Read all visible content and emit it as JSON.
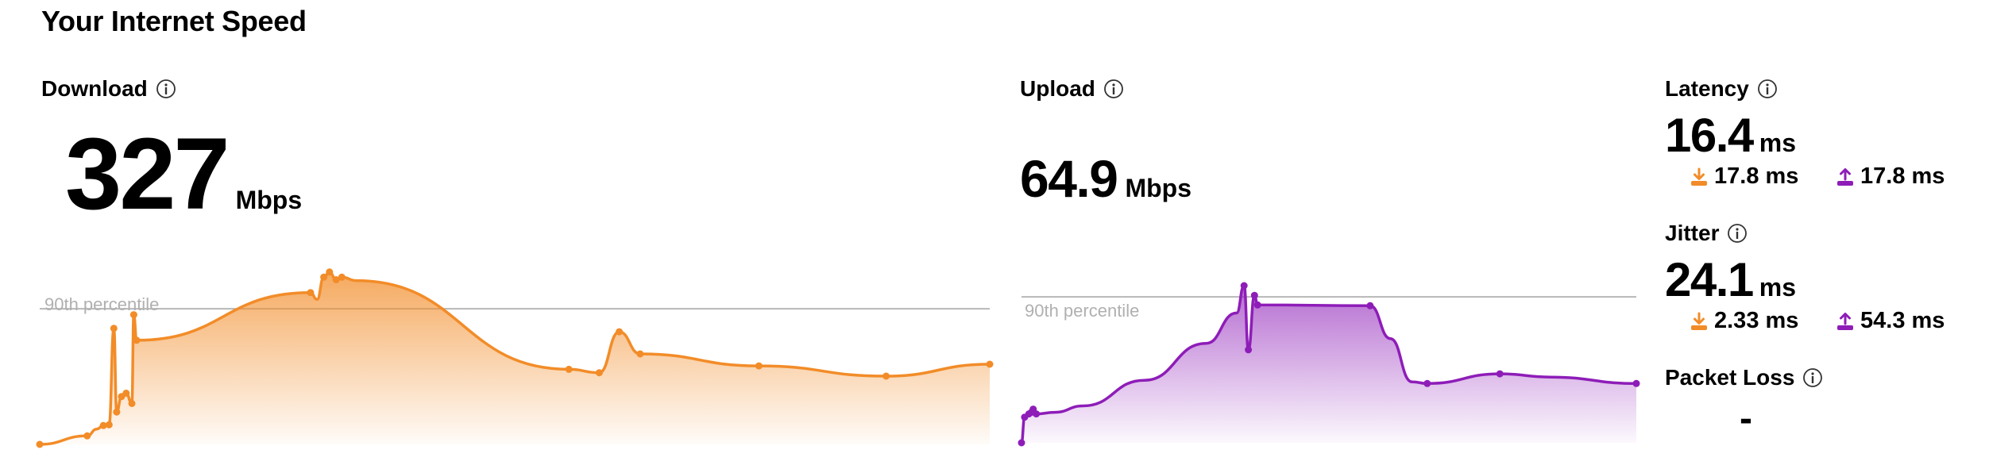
{
  "page": {
    "title": "Your Internet Speed"
  },
  "colors": {
    "download": "#f28c28",
    "upload": "#8e1db8",
    "reference_line": "#b7b7b7",
    "reference_text": "#b0b0b0"
  },
  "download": {
    "label": "Download",
    "value": "327",
    "unit": "Mbps",
    "percentile_label": "90th percentile",
    "info_icon": "info-circle-icon"
  },
  "upload": {
    "label": "Upload",
    "value": "64.9",
    "unit": "Mbps",
    "percentile_label": "90th percentile",
    "info_icon": "info-circle-icon"
  },
  "latency": {
    "label": "Latency",
    "value": "16.4",
    "unit": "ms",
    "down_value": "17.8 ms",
    "up_value": "17.8 ms",
    "down_icon": "download-arrow-icon",
    "up_icon": "upload-arrow-icon"
  },
  "jitter": {
    "label": "Jitter",
    "value": "24.1",
    "unit": "ms",
    "down_value": "2.33 ms",
    "up_value": "54.3 ms",
    "down_icon": "download-arrow-icon",
    "up_icon": "upload-arrow-icon"
  },
  "packet_loss": {
    "label": "Packet Loss",
    "value": "-"
  },
  "chart_data": [
    {
      "type": "area",
      "name": "download",
      "xlim": [
        0,
        100
      ],
      "ylim": [
        0,
        100
      ],
      "reference_line": {
        "label": "90th percentile",
        "y": 79.5
      },
      "points": [
        [
          0,
          0
        ],
        [
          5,
          5
        ],
        [
          6,
          9
        ],
        [
          6.7,
          11
        ],
        [
          7.3,
          11.5
        ],
        [
          7.8,
          68
        ],
        [
          8.1,
          19
        ],
        [
          8.6,
          28
        ],
        [
          9.1,
          30
        ],
        [
          9.7,
          24
        ],
        [
          9.9,
          76
        ],
        [
          10.2,
          61
        ],
        [
          28.5,
          89
        ],
        [
          29.2,
          85
        ],
        [
          29.9,
          98
        ],
        [
          30.5,
          101
        ],
        [
          31.2,
          96.5
        ],
        [
          31.8,
          98
        ],
        [
          33.3,
          96
        ],
        [
          55.7,
          44
        ],
        [
          58.9,
          42
        ],
        [
          61,
          66
        ],
        [
          63.2,
          53
        ],
        [
          75.7,
          46
        ],
        [
          89.1,
          40
        ],
        [
          100,
          47
        ]
      ],
      "markers": [
        0,
        5,
        6.7,
        7.3,
        7.8,
        8.1,
        8.6,
        9.1,
        9.7,
        9.9,
        10.2,
        28.5,
        29.9,
        30.5,
        31.2,
        31.8,
        55.7,
        58.9,
        61,
        63.2,
        75.7,
        89.1,
        100
      ]
    },
    {
      "type": "area",
      "name": "upload",
      "xlim": [
        0,
        100
      ],
      "ylim": [
        0,
        100
      ],
      "reference_line": {
        "label": "90th percentile",
        "y": 91
      },
      "points": [
        [
          0,
          0
        ],
        [
          0.5,
          16
        ],
        [
          1.2,
          18
        ],
        [
          1.6,
          19
        ],
        [
          1.9,
          21
        ],
        [
          2.4,
          18
        ],
        [
          5.4,
          19
        ],
        [
          10,
          23
        ],
        [
          20,
          39
        ],
        [
          30,
          62
        ],
        [
          35,
          81
        ],
        [
          36.2,
          98
        ],
        [
          36.9,
          58
        ],
        [
          37.9,
          92
        ],
        [
          38.4,
          86
        ],
        [
          56.7,
          85.5
        ],
        [
          60,
          65
        ],
        [
          63.5,
          38
        ],
        [
          66,
          37
        ],
        [
          77.8,
          43
        ],
        [
          86,
          41
        ],
        [
          100,
          37
        ]
      ],
      "markers": [
        0,
        0.5,
        1.2,
        1.6,
        1.9,
        2.4,
        36.2,
        36.9,
        37.9,
        38.4,
        56.7,
        66,
        77.8,
        100
      ]
    }
  ]
}
